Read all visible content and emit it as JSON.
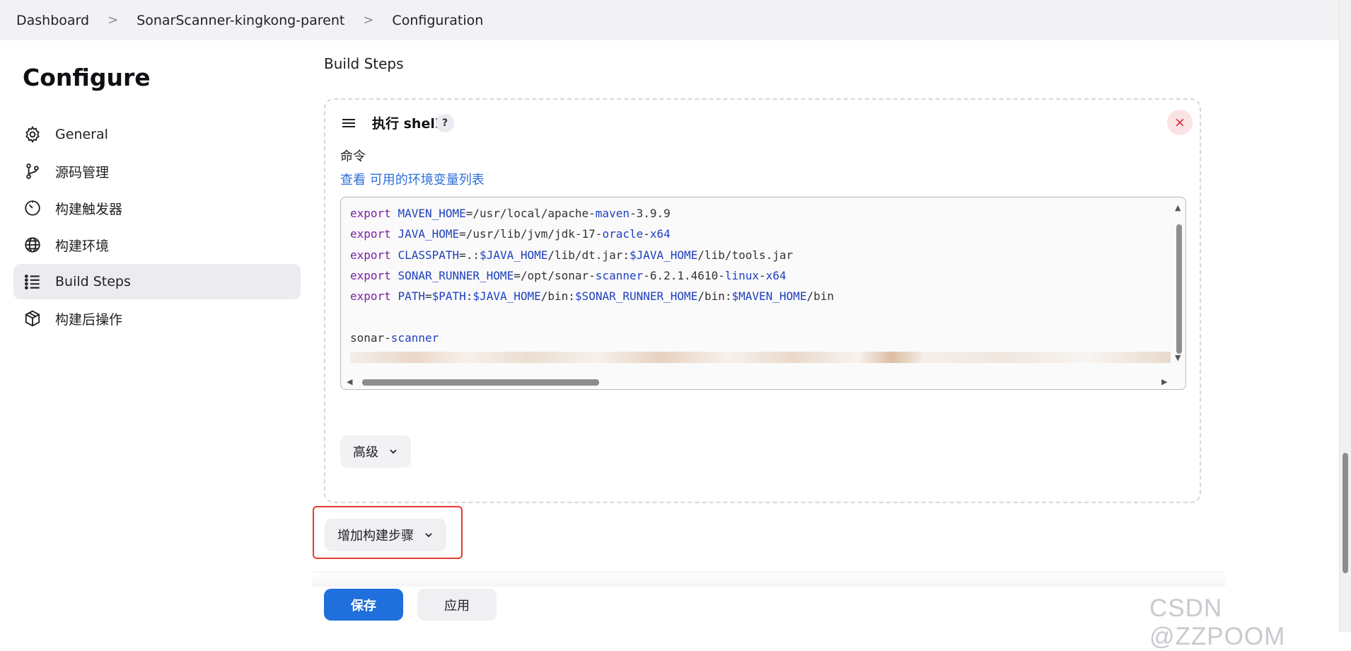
{
  "breadcrumb": {
    "items": [
      "Dashboard",
      "SonarScanner-kingkong-parent",
      "Configuration"
    ],
    "separator": ">"
  },
  "sidebar": {
    "title": "Configure",
    "items": [
      {
        "label": "General",
        "icon": "gear-icon"
      },
      {
        "label": "源码管理",
        "icon": "branch-icon"
      },
      {
        "label": "构建触发器",
        "icon": "clock-icon"
      },
      {
        "label": "构建环境",
        "icon": "globe-icon"
      },
      {
        "label": "Build Steps",
        "icon": "list-icon",
        "active": true
      },
      {
        "label": "构建后操作",
        "icon": "package-icon"
      }
    ]
  },
  "main": {
    "section_title": "Build Steps",
    "step": {
      "name": "执行 shell",
      "help": "?",
      "close": "×",
      "command_label": "命令",
      "env_prefix": "查看",
      "env_link": "可用的环境变量列表",
      "code_lines": [
        "export MAVEN_HOME=/usr/local/apache-maven-3.9.9",
        "export JAVA_HOME=/usr/lib/jvm/jdk-17-oracle-x64",
        "export CLASSPATH=.:$JAVA_HOME/lib/dt.jar:$JAVA_HOME/lib/tools.jar",
        "export SONAR_RUNNER_HOME=/opt/sonar-scanner-6.2.1.4610-linux-x64",
        "export PATH=$PATH:$JAVA_HOME/bin:$SONAR_RUNNER_HOME/bin:$MAVEN_HOME/bin",
        "",
        "sonar-scanner"
      ],
      "advanced_label": "高级"
    },
    "add_step_label": "增加构建步骤",
    "save_label": "保存",
    "apply_label": "应用"
  },
  "watermark": "CSDN @ZZPOOM",
  "colors": {
    "primary": "#1f6fdc",
    "link": "#2f6fd8",
    "danger": "#d2232f",
    "highlight": "#e23b2e"
  }
}
